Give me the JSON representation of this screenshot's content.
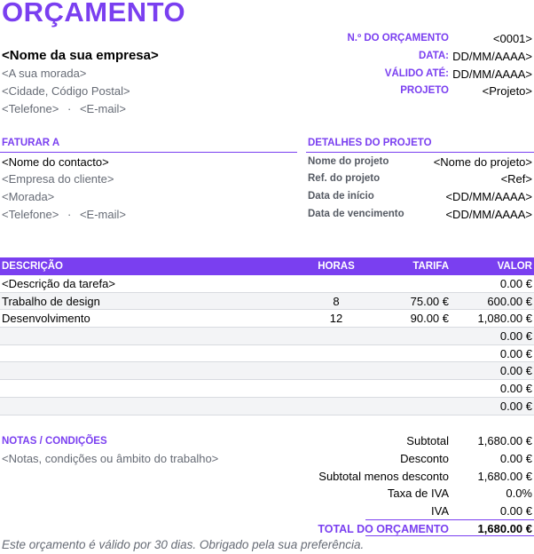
{
  "title": "ORÇAMENTO",
  "company": {
    "name": "<Nome da sua empresa>",
    "address": "<A sua morada>",
    "city": "<Cidade, Código Postal>",
    "phone": "<Telefone>",
    "separator": "·",
    "email": "<E-mail>"
  },
  "meta": {
    "number_label": "N.º DO ORÇAMENTO",
    "number_value": "<0001>",
    "date_label": "DATA:",
    "date_value": "DD/MM/AAAA>",
    "valid_label": "VÁLIDO ATÉ:",
    "valid_value": "DD/MM/AAAA>",
    "project_label": "PROJETO",
    "project_value": "<Projeto>"
  },
  "bill_to": {
    "header": "FATURAR A",
    "contact": "<Nome do contacto>",
    "client_company": "<Empresa do cliente>",
    "address": "<Morada>",
    "phone": "<Telefone>",
    "separator": "·",
    "email": "<E-mail>"
  },
  "project_details": {
    "header": "DETALHES DO PROJETO",
    "rows": [
      {
        "label": "Nome do projeto",
        "value": "<Nome do projeto>"
      },
      {
        "label": "Ref. do projeto",
        "value": "<Ref>"
      },
      {
        "label": "Data de início",
        "value": "<DD/MM/AAAA>"
      },
      {
        "label": "Data de vencimento",
        "value": "<DD/MM/AAAA>"
      }
    ]
  },
  "table": {
    "headers": {
      "description": "DESCRIÇÃO",
      "hours": "HORAS",
      "rate": "TARIFA",
      "amount": "VALOR"
    },
    "rows": [
      {
        "description": "<Descrição da tarefa>",
        "hours": "",
        "rate": "",
        "amount": "0.00 €"
      },
      {
        "description": "Trabalho de design",
        "hours": "8",
        "rate": "75.00 €",
        "amount": "600.00 €"
      },
      {
        "description": "Desenvolvimento",
        "hours": "12",
        "rate": "90.00 €",
        "amount": "1,080.00 €"
      },
      {
        "description": "",
        "hours": "",
        "rate": "",
        "amount": "0.00 €"
      },
      {
        "description": "",
        "hours": "",
        "rate": "",
        "amount": "0.00 €"
      },
      {
        "description": "",
        "hours": "",
        "rate": "",
        "amount": "0.00 €"
      },
      {
        "description": "",
        "hours": "",
        "rate": "",
        "amount": "0.00 €"
      },
      {
        "description": "",
        "hours": "",
        "rate": "",
        "amount": "0.00 €"
      }
    ]
  },
  "notes": {
    "header": "NOTAS / CONDIÇÕES",
    "text": "<Notas, condições ou âmbito do trabalho>"
  },
  "totals": {
    "subtotal_label": "Subtotal",
    "subtotal_value": "1,680.00 €",
    "discount_label": "Desconto",
    "discount_value": "0.00 €",
    "sub_less_label": "Subtotal menos desconto",
    "sub_less_value": "1,680.00 €",
    "tax_rate_label": "Taxa de IVA",
    "tax_rate_value": "0.0%",
    "vat_label": "IVA",
    "vat_value": "0.00 €",
    "total_label": "TOTAL DO ORÇAMENTO",
    "total_value": "1,680.00 €"
  },
  "footer": "Este orçamento é válido por 30 dias.  Obrigado pela sua preferência.",
  "colors": {
    "accent": "#7a3ff0",
    "muted_text": "#666b75",
    "row_alt": "#f3f4f6"
  }
}
